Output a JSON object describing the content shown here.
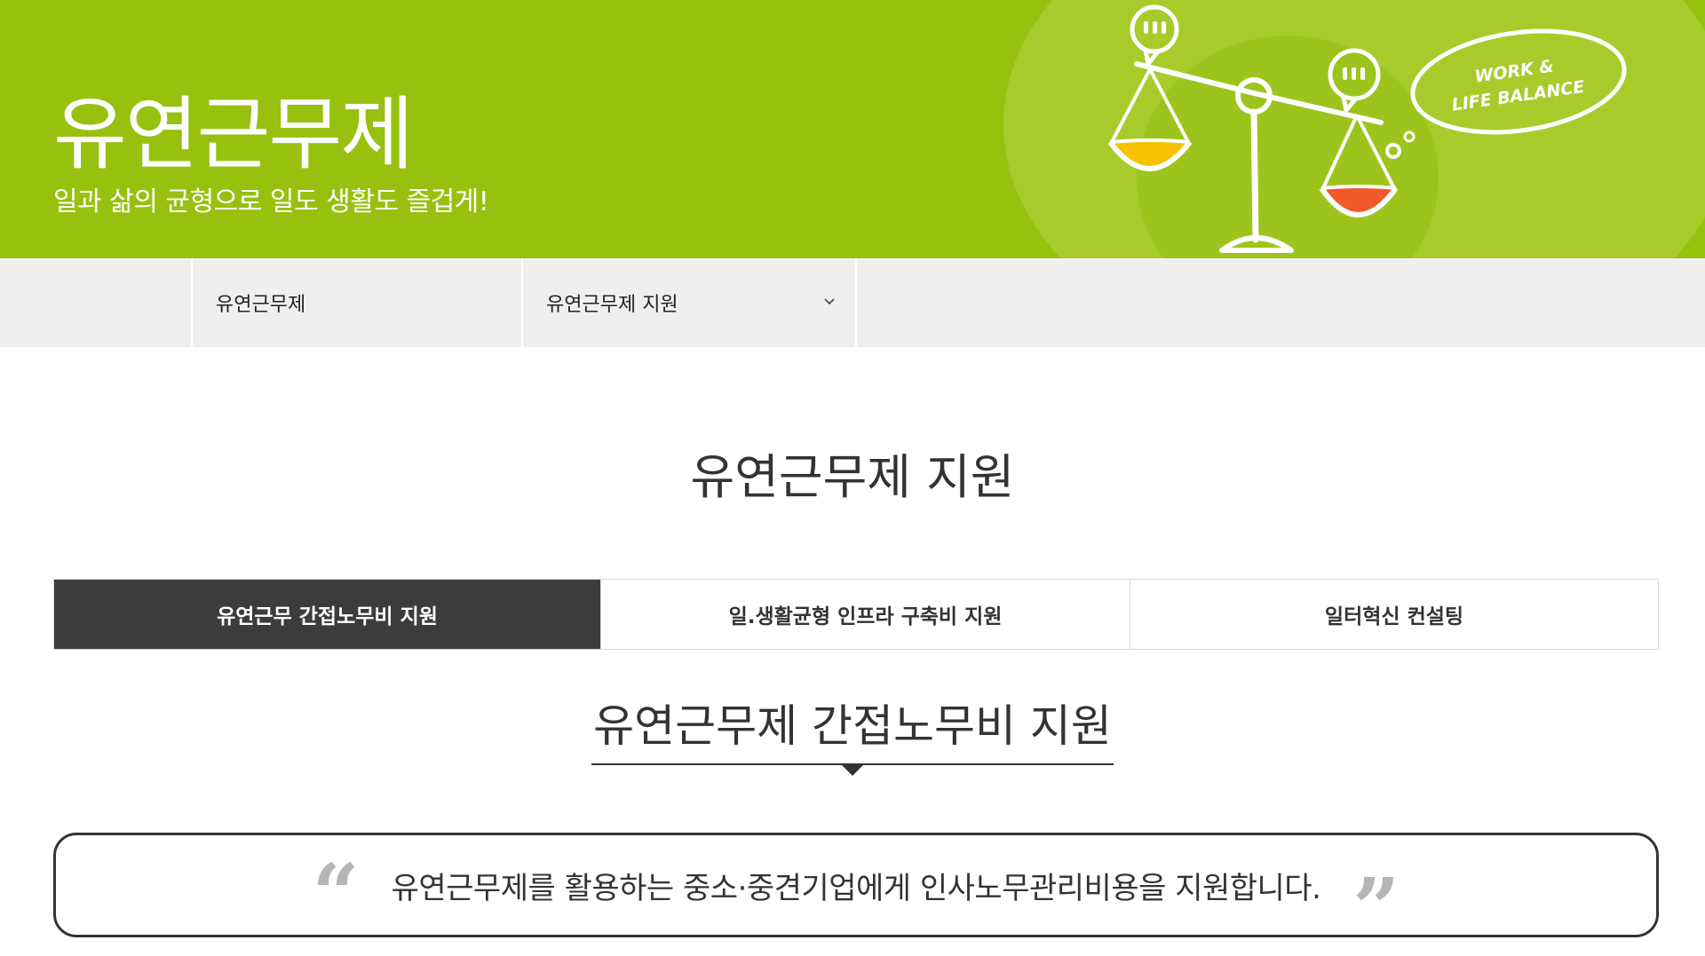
{
  "hero": {
    "title": "유연근무제",
    "subtitle": "일과 삶의 균형으로 일도 생활도 즐겁게!",
    "badge_line1": "WORK &",
    "badge_line2": "LIFE BALANCE"
  },
  "subnav": {
    "menu1": "유연근무제",
    "menu2": "유연근무제 지원"
  },
  "page_title": "유연근무제 지원",
  "tabs": [
    {
      "label": "유연근무 간접노무비 지원",
      "active": true
    },
    {
      "label": "일.생활균형 인프라 구축비 지원",
      "active": false
    },
    {
      "label": "일터혁신 컨설팅",
      "active": false
    }
  ],
  "section_title": "유연근무제 간접노무비 지원",
  "quote": {
    "open_mark": "“",
    "text": "유연근무제를 활용하는 중소·중견기업에게 인사노무관리비용을 지원합니다.",
    "close_mark": "”"
  },
  "colors": {
    "hero_green": "#98c00f",
    "active_tab": "#3c3c3c",
    "subnav_bg": "#efefef"
  }
}
